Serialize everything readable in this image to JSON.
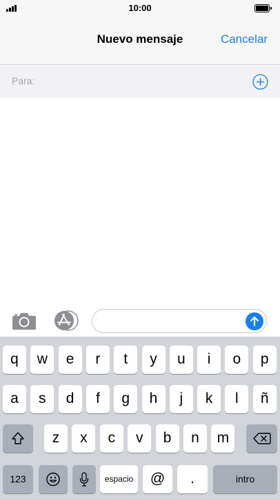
{
  "status_bar": {
    "time": "10:00"
  },
  "nav": {
    "title": "Nuevo mensaje",
    "cancel_label": "Cancelar"
  },
  "recipient": {
    "label": "Para:"
  },
  "keyboard": {
    "row1": [
      "q",
      "w",
      "e",
      "r",
      "t",
      "y",
      "u",
      "i",
      "o",
      "p"
    ],
    "row2": [
      "a",
      "s",
      "d",
      "f",
      "g",
      "h",
      "j",
      "k",
      "l",
      "ñ"
    ],
    "row3": [
      "z",
      "x",
      "c",
      "v",
      "b",
      "n",
      "m"
    ],
    "numbers_label": "123",
    "space_label": "espacio",
    "at_label": "@",
    "period_label": ".",
    "return_label": "intro"
  },
  "colors": {
    "accent": "#1a7ef3",
    "keyboard_bg": "#d1d4d9",
    "dark_key": "#a8aeb8"
  },
  "icons": [
    "signal-icon",
    "battery-icon",
    "add-contact-icon",
    "camera-icon",
    "app-store-icon",
    "send-arrow-icon",
    "shift-icon",
    "backspace-icon",
    "emoji-icon",
    "microphone-icon"
  ]
}
